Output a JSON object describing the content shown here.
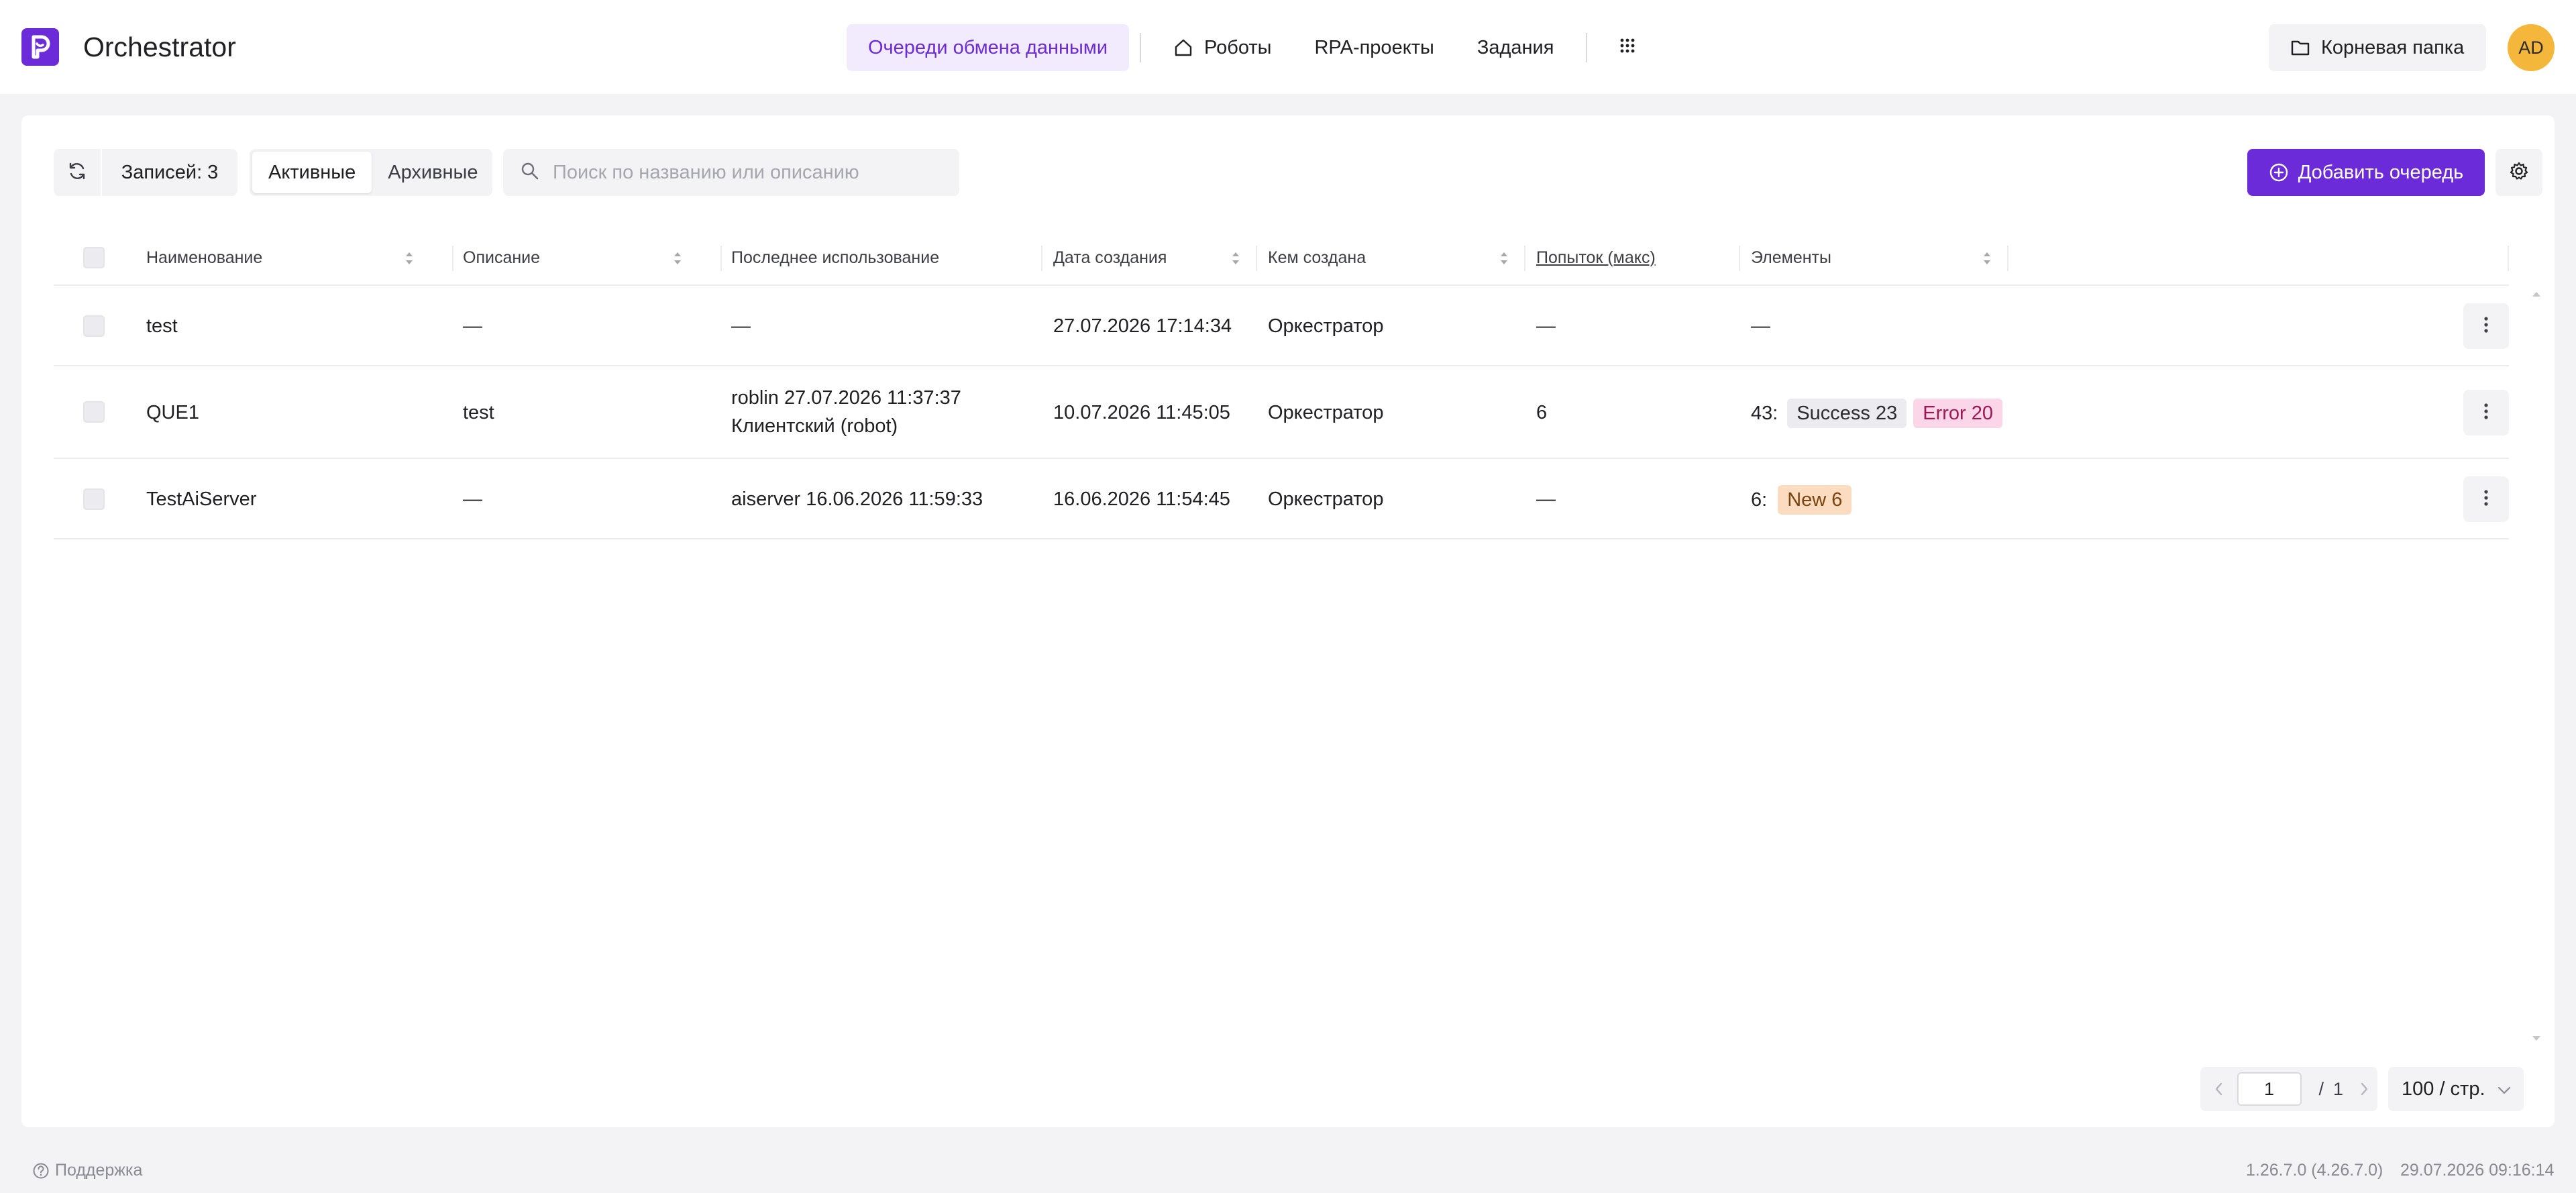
{
  "app": {
    "title": "Orchestrator"
  },
  "nav": {
    "items": [
      {
        "label": "Очереди обмена данными",
        "active": true
      },
      {
        "label": "Роботы",
        "icon": "home-icon"
      },
      {
        "label": "RPA-проекты"
      },
      {
        "label": "Задания"
      }
    ],
    "apps_icon": "grid-icon"
  },
  "header": {
    "root_folder": "Корневая папка",
    "avatar": "AD"
  },
  "toolbar": {
    "records": "Записей: 3",
    "tabs": [
      "Активные",
      "Архивные"
    ],
    "active_tab": "Активные",
    "search_placeholder": "Поиск по названию или описанию",
    "search_value": "",
    "add_button": "Добавить очередь"
  },
  "table": {
    "columns": [
      "Наименование",
      "Описание",
      "Последнее использование",
      "Дата создания",
      "Кем создана",
      "Попыток (макс)",
      "Элементы"
    ],
    "rows": [
      {
        "name": "test",
        "description": "—",
        "last_used": "—",
        "last_used_2": "",
        "created": "27.07.2026 17:14:34",
        "created_by": "Оркестратор",
        "attempts": "—",
        "elements_count": "—",
        "badges": []
      },
      {
        "name": "QUE1",
        "description": "test",
        "last_used": "roblin 27.07.2026 11:37:37",
        "last_used_2": "Клиентский (robot)",
        "created": "10.07.2026 11:45:05",
        "created_by": "Оркестратор",
        "attempts": "6",
        "elements_count": "43:",
        "badges": [
          {
            "label": "Success 23",
            "status": "success"
          },
          {
            "label": "Error 20",
            "status": "error"
          }
        ]
      },
      {
        "name": "TestAiServer",
        "description": "—",
        "last_used": "aiserver 16.06.2026 11:59:33",
        "last_used_2": "",
        "created": "16.06.2026 11:54:45",
        "created_by": "Оркестратор",
        "attempts": "—",
        "elements_count": "6:",
        "badges": [
          {
            "label": "New 6",
            "status": "new"
          }
        ]
      }
    ]
  },
  "pagination": {
    "current": "1",
    "separator": "/",
    "total": "1",
    "per_page": "100 / стр."
  },
  "footer": {
    "support": "Поддержка",
    "version": "1.26.7.0 (4.26.7.0)",
    "datetime": "29.07.2026 09:16:14"
  },
  "colors": {
    "accent": "#6c2bd9",
    "avatar": "#f5b73b",
    "error_badge": "#fbd5e8",
    "new_badge": "#fcdcc0"
  }
}
